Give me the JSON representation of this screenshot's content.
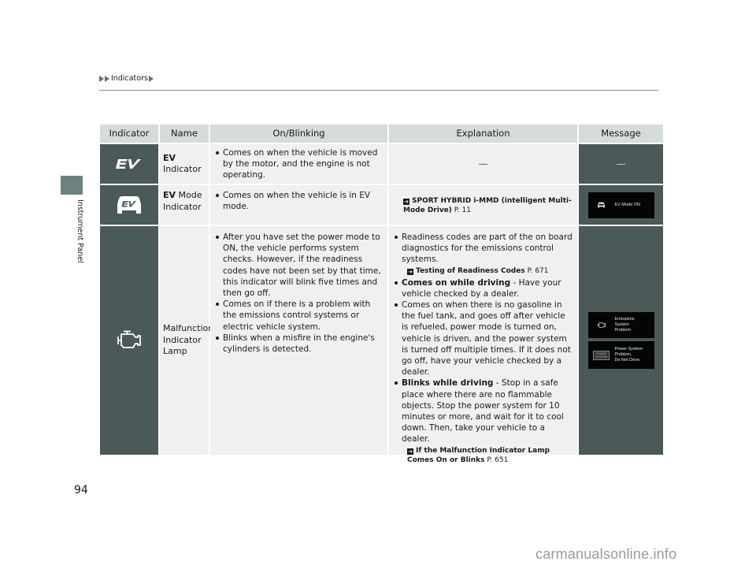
{
  "breadcrumb": {
    "items": [
      "Indicators"
    ]
  },
  "side_tab": {
    "label": "Instrument Panel"
  },
  "page_number": "94",
  "watermark": "carmanualsonline.info",
  "colors": {
    "icon_cell_bg": "#4b5958",
    "header_bg": "#d5dcdb",
    "cell_bg": "#eff0ef",
    "side_tab_bg": "#6d8180"
  },
  "table": {
    "headers": [
      "Indicator",
      "Name",
      "On/Blinking",
      "Explanation",
      "Message"
    ],
    "rows": [
      {
        "icon": "ev-indicator-icon",
        "name_bold": "EV",
        "name_rest": " Indicator",
        "on_blinking": [
          "Comes on when the vehicle is moved by the motor, and the engine is not operating."
        ],
        "explanation": "—",
        "message": "—"
      },
      {
        "icon": "ev-mode-indicator-icon",
        "name_bold": "EV",
        "name_rest": " Mode Indicator",
        "on_blinking": [
          "Comes on when the vehicle is in EV mode."
        ],
        "explanation_ref": {
          "title": "SPORT HYBRID i-MMD (intelligent Multi-Mode Drive)",
          "page": "P. 11"
        },
        "message_screens": [
          {
            "icon": "ev-car-icon",
            "text": "EV Mode ON"
          }
        ]
      },
      {
        "icon": "check-engine-icon",
        "name": "Malfunction Indicator Lamp",
        "on_blinking": [
          "After you have set the power mode to ON, the vehicle performs system checks. However, if the readiness codes have not been set by that time, this indicator will blink five times and then go off.",
          "Comes on if there is a problem with the emissions control systems or electric vehicle system.",
          "Blinks when a misfire in the engine's cylinders is detected."
        ],
        "explanation": {
          "b1": "Readiness codes are part of the on board diagnostics for the emissions control systems.",
          "ref1_title": "Testing of Readiness Codes",
          "ref1_page": "P. 671",
          "b2_bold": "Comes on while driving",
          "b2_rest": " - Have your vehicle checked by a dealer.",
          "b3": "Comes on when there is no gasoline in the fuel tank, and goes off after vehicle is refueled, power mode is turned on, vehicle is driven, and the power system is turned off multiple times. If it does not go off, have your vehicle checked by a dealer.",
          "b4_bold": "Blinks while driving",
          "b4_rest": " - Stop in a safe place where there are no flammable objects. Stop the power system for 10 minutes or more, and wait for it to cool down. Then, take your vehicle to a dealer.",
          "ref2_title": "If the Malfunction Indicator Lamp Comes On or Blinks",
          "ref2_page": "P. 651"
        },
        "message_screens": [
          {
            "icon": "check-engine-icon",
            "lines": [
              "Emissions",
              "System",
              "Problem"
            ]
          },
          {
            "icon": "power-system-icon",
            "icon_text": "POWER SYSTEM",
            "lines": [
              "Power System",
              "Problem.",
              "Do Not Drive."
            ]
          }
        ]
      }
    ]
  }
}
